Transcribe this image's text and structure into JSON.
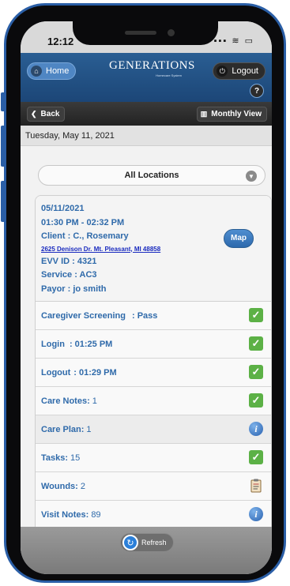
{
  "status": {
    "time": "12:12",
    "icons": "▪▪▪ ≋ ▭"
  },
  "header": {
    "home_label": "Home",
    "logo": "GENERATIONS",
    "logo_sub": "Homecare System",
    "logout_label": "Logout",
    "help_label": "?"
  },
  "nav": {
    "back_label": "Back",
    "monthly_label": "Monthly View"
  },
  "date": "Tuesday, May 11, 2021",
  "locations": {
    "selected": "All Locations"
  },
  "visit": {
    "date": "05/11/2021",
    "time": "01:30 PM - 02:32 PM",
    "client": "Client : C., Rosemary",
    "address": "2625 Denison Dr. Mt. Pleasant, MI 48858",
    "evv": "EVV ID : 4321",
    "service": "Service : AC3",
    "payor": "Payor : jo smith",
    "map_label": "Map"
  },
  "rows": [
    {
      "label": "Caregiver Screening",
      "value": ": Pass",
      "icon": "check-icon"
    },
    {
      "label": "Login",
      "value": ": 01:25 PM",
      "icon": "check-icon"
    },
    {
      "label": "Logout",
      "value": ": 01:29 PM",
      "icon": "check-icon"
    },
    {
      "label": "Care Notes:",
      "value": "1",
      "icon": "check-icon"
    },
    {
      "label": "Care Plan:",
      "value": "1",
      "icon": "info-icon"
    },
    {
      "label": "Tasks:",
      "value": "15",
      "icon": "check-icon"
    },
    {
      "label": "Wounds:",
      "value": "2",
      "icon": "clipboard-icon"
    },
    {
      "label": "Visit Notes:",
      "value": "89",
      "icon": "info-icon"
    }
  ],
  "footer": {
    "refresh_label": "Refresh"
  },
  "colors": {
    "header_blue": "#1c4677",
    "link_blue": "#2f6aaa",
    "check_green": "#5cb146",
    "frame_blue": "#2a5ea6"
  }
}
